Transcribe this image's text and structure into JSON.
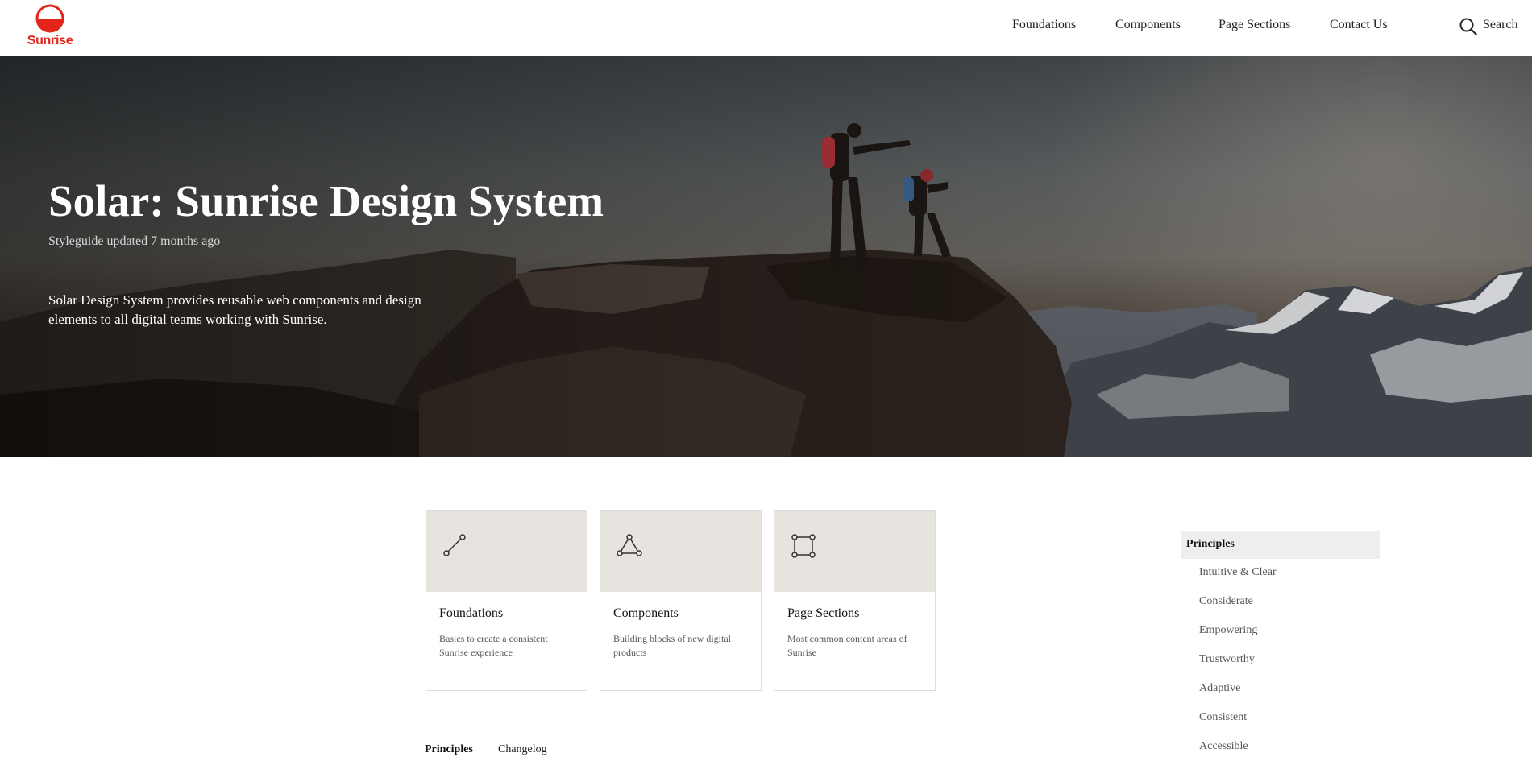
{
  "header": {
    "logo_text": "Sunrise",
    "nav": [
      "Foundations",
      "Components",
      "Page Sections",
      "Contact Us"
    ],
    "search_label": "Search"
  },
  "hero": {
    "title": "Solar: Sunrise Design System",
    "updated": "Styleguide updated 7 months ago",
    "description": "Solar Design System provides reusable web components and design elements to all digital teams working with Sunrise."
  },
  "cards": [
    {
      "icon": "line-segment-icon",
      "title": "Foundations",
      "description": "Basics to create a consistent Sunrise experience"
    },
    {
      "icon": "triangle-nodes-icon",
      "title": "Components",
      "description": "Building blocks of new digital products"
    },
    {
      "icon": "square-nodes-icon",
      "title": "Page Sections",
      "description": "Most common content areas of Sunrise"
    }
  ],
  "tabs": [
    "Principles",
    "Changelog"
  ],
  "sidenav": {
    "heading": "Principles",
    "items": [
      "Intuitive & Clear",
      "Considerate",
      "Empowering",
      "Trustworthy",
      "Adaptive",
      "Consistent",
      "Accessible"
    ]
  },
  "colors": {
    "brand": "#e3241b",
    "card_header": "#e7e4e0",
    "sidenav_active": "#eeeeee"
  }
}
